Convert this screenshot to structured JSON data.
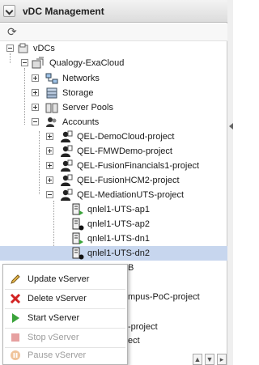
{
  "panel": {
    "title": "vDC Management"
  },
  "tree": {
    "root": "vDCs",
    "cloud": "Qualogy-ExaCloud",
    "groups": [
      "Networks",
      "Storage",
      "Server Pools",
      "Accounts"
    ],
    "accounts": [
      "QEL-DemoCloud-project",
      "QEL-FMWDemo-project",
      "QEL-FusionFinancials1-project",
      "QEL-FusionHCM2-project",
      "QEL-MediationUTS-project"
    ],
    "vservers": [
      {
        "label": "qnlel1-UTS-ap1",
        "status": "running"
      },
      {
        "label": "qnlel1-UTS-ap2",
        "status": "stopped"
      },
      {
        "label": "qnlel1-UTS-dn1",
        "status": "running"
      },
      {
        "label": "qnlel1-UTS-dn2",
        "status": "stopped",
        "selected": true
      }
    ],
    "partial_rows": [
      "B",
      "mpus-PoC-project",
      "-project",
      "ect"
    ]
  },
  "context_menu": {
    "items": [
      {
        "label": "Update vServer",
        "icon": "pencil-icon",
        "enabled": true
      },
      {
        "label": "Delete vServer",
        "icon": "delete-x-icon",
        "enabled": true
      },
      {
        "label": "Start vServer",
        "icon": "play-icon",
        "enabled": true
      },
      {
        "label": "Stop vServer",
        "icon": "stop-icon",
        "enabled": false
      },
      {
        "label": "Pause vServer",
        "icon": "pause-icon",
        "enabled": false
      }
    ]
  },
  "colors": {
    "selection": "#c7d6ee",
    "running": "#3aa33a",
    "delete": "#d22222"
  }
}
